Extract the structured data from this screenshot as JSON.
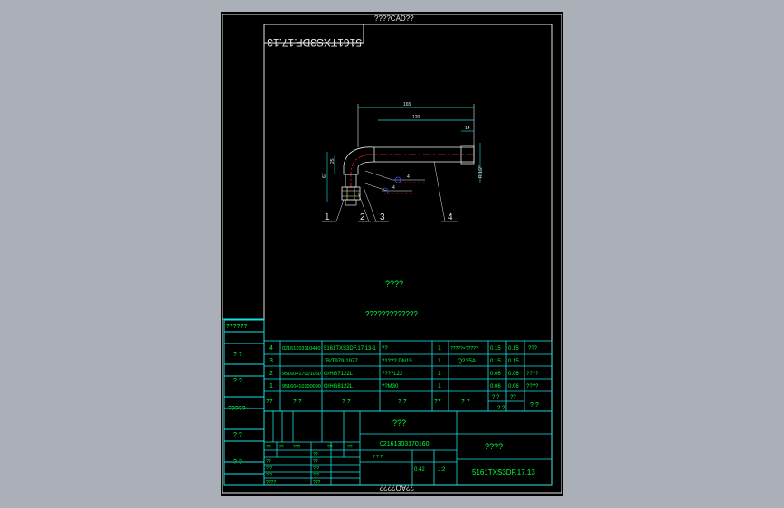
{
  "header_label": "????CAD??",
  "footer_label": "??AO????",
  "right_margin_label": "????????",
  "drawing_number_mirror": "5161TXS3DF.17.13",
  "left_blocks": [
    "??????",
    "? ?",
    "? ?",
    "?????",
    "? ?",
    "? ?"
  ],
  "dimensions": {
    "d165": "165",
    "d120": "120",
    "d25": "25",
    "d67": "67",
    "d14": "14",
    "d40": "R 1/2\""
  },
  "callouts": [
    "1",
    "2",
    "3",
    "4"
  ],
  "weld_symbol_label": "4",
  "notes_title": "????",
  "notes_body": "?????????????",
  "bom_rows": [
    {
      "no": "4",
      "code": "02161303110440",
      "spec": "5161TXS3DF.17.13-1",
      "name": "??",
      "qty": "1",
      "mat": "?????×?????",
      "w1": "0.15",
      "w2": "0.15",
      "rem": "???"
    },
    {
      "no": "3",
      "code": "",
      "spec": "JB/T979-1977",
      "name": "?1???  DN15",
      "qty": "1",
      "mat": "Q235A",
      "w1": "0.15",
      "w2": "0.15",
      "rem": ""
    },
    {
      "no": "2",
      "code": "95160417001060",
      "spec": "Q/HG7122L",
      "name": "????L22",
      "qty": "1",
      "mat": "",
      "w1": "0.06",
      "w2": "0.06",
      "rem": "????"
    },
    {
      "no": "1",
      "code": "95160410100090",
      "spec": "Q/HG8122L",
      "name": "??M30",
      "qty": "1",
      "mat": "",
      "w1": "0.06",
      "w2": "0.06",
      "rem": "????"
    }
  ],
  "bom_header": {
    "no": "??",
    "code": "? ?",
    "spec": "? ?",
    "name": "? ?",
    "qty": "??",
    "mat": "? ?",
    "w1": "? ?",
    "w2": "??",
    "weight": "? ?",
    "rem": "? ?"
  },
  "title_block": {
    "name_top": "???",
    "doc_code": "02161303170160",
    "company": "????",
    "drawing_no": "5161TXS3DF.17.13",
    "stage": "? ? ?",
    "weight": "0.42",
    "scale": "1:2",
    "labels_left": [
      "??",
      "??",
      "? ?",
      "? ?",
      "????"
    ],
    "labels_left2": [
      "??",
      "??",
      "? ?",
      "? ?",
      "???"
    ],
    "small_labels": [
      "??",
      "???",
      "??",
      "??"
    ]
  },
  "colors": {
    "frame": "#19e1e1",
    "text": "#00ff3c",
    "white": "#e6e6e6",
    "red": "#ff2020",
    "yellow": "#ffff40",
    "blue": "#3050ff"
  }
}
